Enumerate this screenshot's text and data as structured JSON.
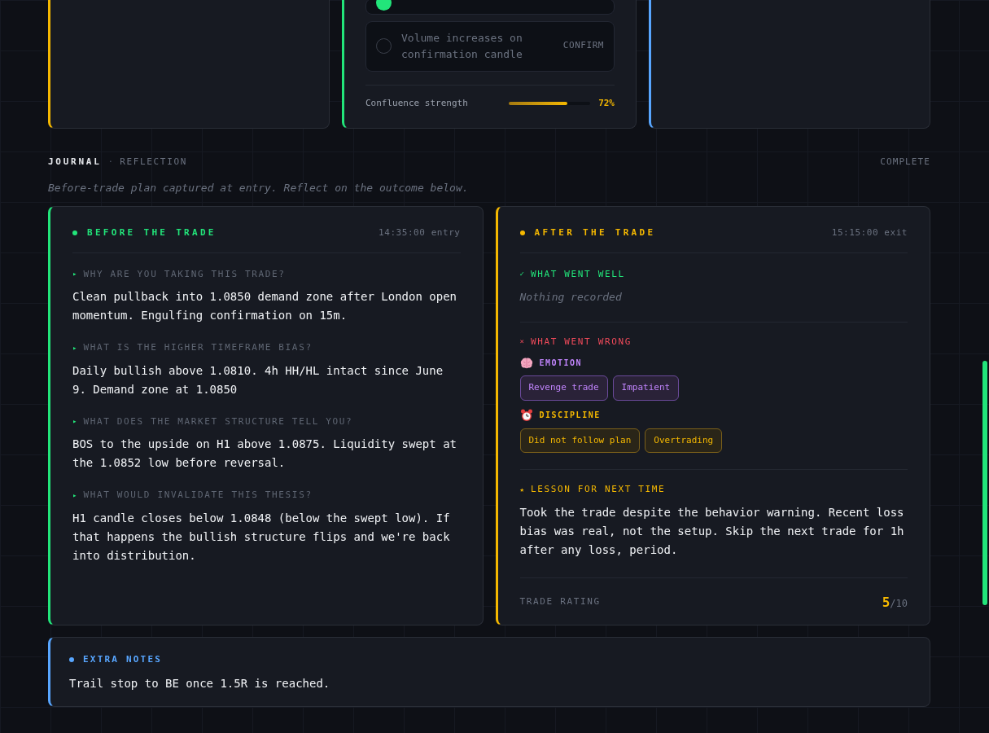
{
  "top_cards": [
    {
      "kind": "empty",
      "color": "#f5b800"
    },
    {
      "kind": "checklist",
      "color": "#22e57a",
      "items": [
        {
          "checked": true
        },
        {
          "checked": false,
          "text": "Volume increases on confirmation candle",
          "tag": "CONFIRM"
        }
      ],
      "strength": {
        "label": "Confluence strength",
        "level": 0.72,
        "reading": "72%"
      }
    },
    {
      "kind": "empty",
      "color": "#58a6ff"
    }
  ],
  "journal": {
    "title": "JOURNAL",
    "separator": "·",
    "subtitle": "REFLECTION",
    "status": "COMPLETE",
    "description": "Before-trade plan captured at entry. Reflect on the outcome below."
  },
  "before": {
    "title": "BEFORE THE TRADE",
    "time": "14:35:00 entry",
    "marker": "▸",
    "questions": [
      {
        "question": "WHY ARE YOU TAKING THIS TRADE?",
        "answer": "Clean pullback into 1.0850 demand zone after London open momentum. Engulfing confirmation on 15m."
      },
      {
        "question": "WHAT IS THE HIGHER TIMEFRAME BIAS?",
        "answer": "Daily bullish above 1.0810. 4h HH/HL intact since June 9. Demand zone at 1.0850"
      },
      {
        "question": "WHAT DOES THE MARKET STRUCTURE TELL YOU?",
        "answer": "BOS to the upside on H1 above 1.0875. Liquidity swept at the 1.0852 low before reversal."
      },
      {
        "question": "WHAT WOULD INVALIDATE THIS THESIS?",
        "answer": "H1 candle closes below 1.0848 (below the swept low). If that happens the bullish structure flips and we're back into distribution."
      }
    ]
  },
  "after": {
    "title": "AFTER THE TRADE",
    "time": "15:15:00 exit",
    "well": {
      "mark": "✓",
      "title": "WHAT WENT WELL",
      "empty_text": "Nothing recorded"
    },
    "wrong": {
      "mark": "×",
      "title": "WHAT WENT WRONG",
      "groups": [
        {
          "kind": "emotion",
          "label": "EMOTION",
          "color": "#c084fc",
          "tags": [
            "Revenge trade",
            "Impatient"
          ]
        },
        {
          "kind": "discipline",
          "label": "DISCIPLINE",
          "color": "#f5b800",
          "tags": [
            "Did not follow plan",
            "Overtrading"
          ]
        }
      ]
    },
    "lesson": {
      "mark": "★",
      "title": "LESSON FOR NEXT TIME",
      "text": "Took the trade despite the behavior warning. Recent loss bias was real, not the setup. Skip the next trade for 1h after any loss, period."
    },
    "rating": {
      "label": "TRADE RATING",
      "value": "5",
      "scale": "/10"
    }
  },
  "notes": {
    "title": "EXTRA NOTES",
    "text": "Trail stop to BE once 1.5R is reached."
  }
}
